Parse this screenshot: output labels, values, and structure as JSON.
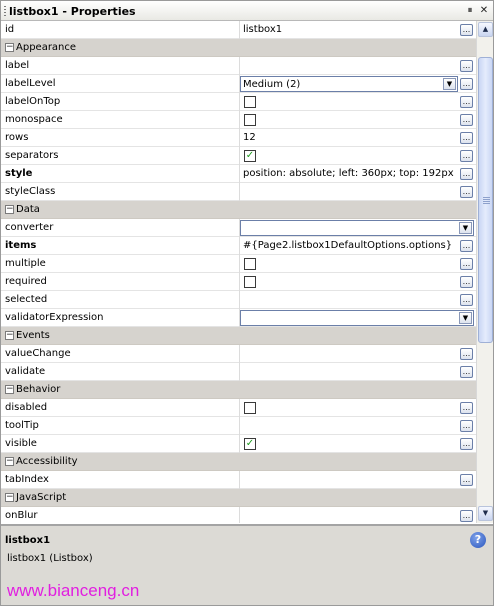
{
  "window": {
    "title": "listbox1 - Properties",
    "controls": [
      "pin-icon",
      "close-icon"
    ]
  },
  "rows": [
    {
      "kind": "prop",
      "name": "id",
      "value": "listbox1",
      "editor": "text",
      "bold": false
    },
    {
      "kind": "cat",
      "name": "Appearance"
    },
    {
      "kind": "prop",
      "name": "label",
      "value": "",
      "editor": "text",
      "bold": false
    },
    {
      "kind": "prop",
      "name": "labelLevel",
      "value": "Medium (2)",
      "editor": "combo-ellipsis",
      "bold": false
    },
    {
      "kind": "prop",
      "name": "labelOnTop",
      "value": "",
      "editor": "checkbox",
      "checked": false,
      "bold": false
    },
    {
      "kind": "prop",
      "name": "monospace",
      "value": "",
      "editor": "checkbox",
      "checked": false,
      "bold": false
    },
    {
      "kind": "prop",
      "name": "rows",
      "value": "12",
      "editor": "text",
      "bold": false
    },
    {
      "kind": "prop",
      "name": "separators",
      "value": "",
      "editor": "checkbox",
      "checked": true,
      "bold": false
    },
    {
      "kind": "prop",
      "name": "style",
      "value": "position: absolute; left: 360px; top: 192px",
      "editor": "text",
      "bold": true
    },
    {
      "kind": "prop",
      "name": "styleClass",
      "value": "",
      "editor": "text",
      "bold": false
    },
    {
      "kind": "cat",
      "name": "Data"
    },
    {
      "kind": "prop",
      "name": "converter",
      "value": "",
      "editor": "combo",
      "bold": false
    },
    {
      "kind": "prop",
      "name": "items",
      "value": "#{Page2.listbox1DefaultOptions.options}",
      "editor": "text",
      "bold": true
    },
    {
      "kind": "prop",
      "name": "multiple",
      "value": "",
      "editor": "checkbox",
      "checked": false,
      "bold": false
    },
    {
      "kind": "prop",
      "name": "required",
      "value": "",
      "editor": "checkbox",
      "checked": false,
      "bold": false
    },
    {
      "kind": "prop",
      "name": "selected",
      "value": "",
      "editor": "text",
      "bold": false
    },
    {
      "kind": "prop",
      "name": "validatorExpression",
      "value": "",
      "editor": "combo",
      "bold": false
    },
    {
      "kind": "cat",
      "name": "Events"
    },
    {
      "kind": "prop",
      "name": "valueChange",
      "value": "",
      "editor": "text",
      "bold": false
    },
    {
      "kind": "prop",
      "name": "validate",
      "value": "",
      "editor": "text",
      "bold": false
    },
    {
      "kind": "cat",
      "name": "Behavior"
    },
    {
      "kind": "prop",
      "name": "disabled",
      "value": "",
      "editor": "checkbox",
      "checked": false,
      "bold": false
    },
    {
      "kind": "prop",
      "name": "toolTip",
      "value": "",
      "editor": "text",
      "bold": false
    },
    {
      "kind": "prop",
      "name": "visible",
      "value": "",
      "editor": "checkbox",
      "checked": true,
      "bold": false
    },
    {
      "kind": "cat",
      "name": "Accessibility"
    },
    {
      "kind": "prop",
      "name": "tabIndex",
      "value": "",
      "editor": "text",
      "bold": false
    },
    {
      "kind": "cat",
      "name": "JavaScript"
    },
    {
      "kind": "prop",
      "name": "onBlur",
      "value": "",
      "editor": "text",
      "bold": false
    }
  ],
  "description": {
    "title": "listbox1",
    "text": "listbox1 (Listbox)"
  },
  "icons": {
    "ellipsis": "...",
    "collapse": "−",
    "check": "✓",
    "dropdown": "▼",
    "scroll_up": "▲",
    "scroll_down": "▼",
    "help": "?"
  },
  "watermark": "www.bianceng.cn",
  "colors": {
    "category_bg": "#d6d3ce",
    "check": "#1d9a1d",
    "help": "#2b56bd",
    "watermark": "#e11fe0"
  }
}
